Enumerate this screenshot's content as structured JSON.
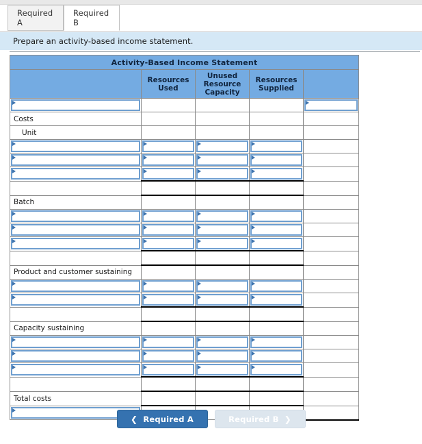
{
  "tabs": [
    {
      "label": "Required A",
      "active": false
    },
    {
      "label": "Required B",
      "active": true
    }
  ],
  "instruction": {
    "text": "Prepare an activity-based income statement."
  },
  "worksheet": {
    "title": "Activity-Based Income Statement",
    "columns": [
      {
        "label": ""
      },
      {
        "label": "Resources Used"
      },
      {
        "label": "Unused Resource Capacity"
      },
      {
        "label": "Resources Supplied"
      },
      {
        "label": ""
      }
    ],
    "column_header_lines": [
      [],
      [
        "Resources",
        "Used"
      ],
      [
        "Unused",
        "Resource",
        "Capacity"
      ],
      [
        "Resources",
        "Supplied"
      ],
      []
    ],
    "rows": [
      {
        "type": "input",
        "label": "",
        "inputs": [
          true,
          false,
          false,
          false,
          true
        ]
      },
      {
        "type": "label",
        "label": "Costs",
        "indent": false
      },
      {
        "type": "label",
        "label": "Unit",
        "indent": true
      },
      {
        "type": "input",
        "label": "",
        "inputs": [
          true,
          true,
          true,
          true,
          false
        ]
      },
      {
        "type": "input",
        "label": "",
        "inputs": [
          true,
          true,
          true,
          true,
          false
        ]
      },
      {
        "type": "input",
        "label": "",
        "inputs": [
          true,
          true,
          true,
          true,
          false
        ],
        "rule_below": true
      },
      {
        "type": "blank",
        "label": "",
        "rule_below": true
      },
      {
        "type": "label",
        "label": "Batch",
        "indent": false
      },
      {
        "type": "input",
        "label": "",
        "inputs": [
          true,
          true,
          true,
          true,
          false
        ]
      },
      {
        "type": "input",
        "label": "",
        "inputs": [
          true,
          true,
          true,
          true,
          false
        ]
      },
      {
        "type": "input",
        "label": "",
        "inputs": [
          true,
          true,
          true,
          true,
          false
        ],
        "rule_below": true
      },
      {
        "type": "blank",
        "label": "",
        "rule_below": true
      },
      {
        "type": "label",
        "label": "Product and customer sustaining",
        "indent": false
      },
      {
        "type": "input",
        "label": "",
        "inputs": [
          true,
          true,
          true,
          true,
          false
        ]
      },
      {
        "type": "input",
        "label": "",
        "inputs": [
          true,
          true,
          true,
          true,
          false
        ],
        "rule_below": true
      },
      {
        "type": "blank",
        "label": "",
        "rule_below": true
      },
      {
        "type": "label",
        "label": "Capacity sustaining",
        "indent": false
      },
      {
        "type": "input",
        "label": "",
        "inputs": [
          true,
          true,
          true,
          true,
          false
        ]
      },
      {
        "type": "input",
        "label": "",
        "inputs": [
          true,
          true,
          true,
          true,
          false
        ]
      },
      {
        "type": "input",
        "label": "",
        "inputs": [
          true,
          true,
          true,
          true,
          false
        ],
        "rule_below": true
      },
      {
        "type": "blank",
        "label": "",
        "rule_below": true
      },
      {
        "type": "label",
        "label": "Total costs",
        "indent": false,
        "rule_below": true
      },
      {
        "type": "input",
        "label": "",
        "inputs": [
          true,
          false,
          false,
          false,
          false
        ],
        "final": true
      }
    ]
  },
  "nav": {
    "prev": {
      "label": "Required A",
      "icon": "chevron-left-icon",
      "enabled": true
    },
    "next": {
      "label": "Required B",
      "icon": "chevron-right-icon",
      "enabled": false
    }
  },
  "colors": {
    "header_blue": "#74abe2",
    "instruction_blue": "#d5e8f6",
    "primary_button": "#3572b0",
    "disabled_button": "#dde6ee",
    "input_border": "#6f9fd0"
  }
}
